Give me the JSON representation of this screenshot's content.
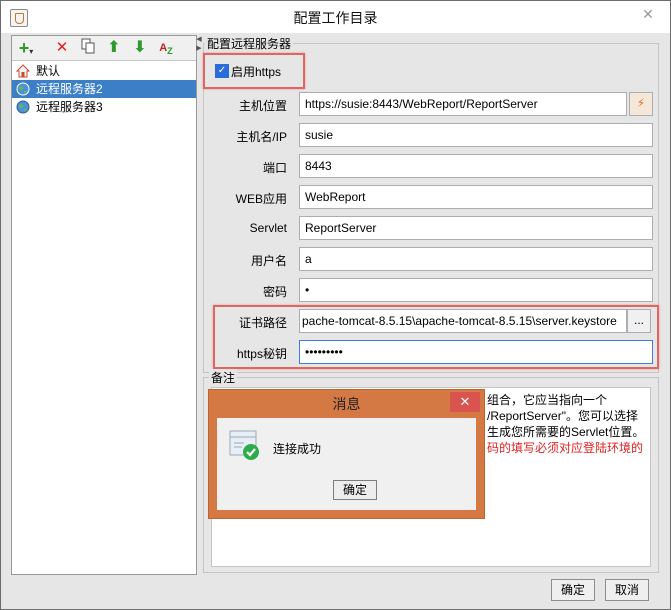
{
  "window": {
    "title": "配置工作目录"
  },
  "toolbar": {
    "add_icon": "add-icon",
    "delete_icon": "delete-icon",
    "copy_icon": "copy-icon",
    "move_up_icon": "arrow-up-icon",
    "move_down_icon": "arrow-down-icon",
    "sort_icon": "sort-icon"
  },
  "tree": {
    "items": [
      {
        "label": "默认",
        "icon": "home-icon",
        "selected": false
      },
      {
        "label": "远程服务器2",
        "icon": "globe-icon",
        "selected": true
      },
      {
        "label": "远程服务器3",
        "icon": "globe-icon",
        "selected": false
      }
    ]
  },
  "remote": {
    "section_title": "配置远程服务器",
    "https_label": "启用https",
    "https_checked": true,
    "fields": {
      "host_location": {
        "label": "主机位置",
        "value": "https://susie:8443/WebReport/ReportServer"
      },
      "host_name": {
        "label": "主机名/IP",
        "value": "susie"
      },
      "port": {
        "label": "端口",
        "value": "8443"
      },
      "web_app": {
        "label": "WEB应用",
        "value": "WebReport"
      },
      "servlet": {
        "label": "Servlet",
        "value": "ReportServer"
      },
      "username": {
        "label": "用户名",
        "value": "a"
      },
      "password": {
        "label": "密码",
        "value": "•"
      },
      "cert_path": {
        "label": "证书路径",
        "value": "pache-tomcat-8.5.15\\apache-tomcat-8.5.15\\server.keystore",
        "browse_label": "..."
      },
      "https_key": {
        "label": "https秘钥",
        "value": "•••••••••"
      }
    }
  },
  "notes": {
    "title": "备注",
    "lines": [
      "组合，它应当指向一个",
      "/ReportServer\"。您可以选择",
      "生成您所需要的Servlet位置。",
      "码的填写必须对应登陆环境的"
    ],
    "red_line": "码的填写必须对应登陆环境的"
  },
  "dialog": {
    "title": "消息",
    "message": "连接成功",
    "ok_label": "确定",
    "close_label": "✕"
  },
  "footer": {
    "ok_label": "确定",
    "cancel_label": "取消"
  }
}
